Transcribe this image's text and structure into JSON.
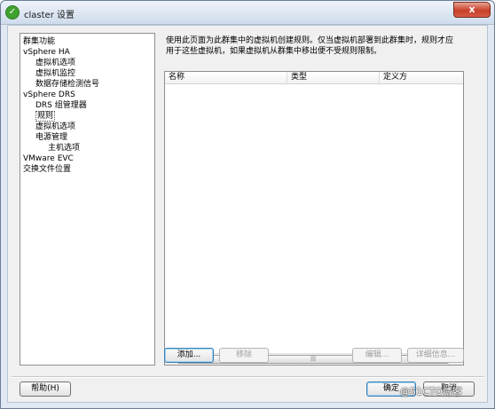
{
  "window": {
    "title": "claster 设置",
    "close_label": "x"
  },
  "tree": {
    "items": [
      {
        "label": "群集功能",
        "level": 0
      },
      {
        "label": "vSphere HA",
        "level": 0
      },
      {
        "label": "虚拟机选项",
        "level": 1
      },
      {
        "label": "虚拟机监控",
        "level": 1
      },
      {
        "label": "数据存储检测信号",
        "level": 1
      },
      {
        "label": "vSphere DRS",
        "level": 0
      },
      {
        "label": "DRS 组管理器",
        "level": 1
      },
      {
        "label": "规则",
        "level": 1,
        "selected": true
      },
      {
        "label": "虚拟机选项",
        "level": 1
      },
      {
        "label": "电源管理",
        "level": 1
      },
      {
        "label": "主机选项",
        "level": 2
      },
      {
        "label": "VMware EVC",
        "level": 0
      },
      {
        "label": "交换文件位置",
        "level": 0
      }
    ]
  },
  "main": {
    "description_line1": "使用此页面为此群集中的虚拟机创建规则。仅当虚拟机部署到此群集时，规则才应",
    "description_line2": "用于这些虚拟机，如果虚拟机从群集中移出便不受规则限制。",
    "columns": [
      "名称",
      "类型",
      "定义方"
    ],
    "rows": []
  },
  "buttons": {
    "add": "添加...",
    "remove": "移除",
    "edit": "编辑...",
    "details": "详细信息...",
    "help": "帮助(H)",
    "ok": "确定",
    "cancel": "取消"
  },
  "watermark": "@51CTO博客"
}
